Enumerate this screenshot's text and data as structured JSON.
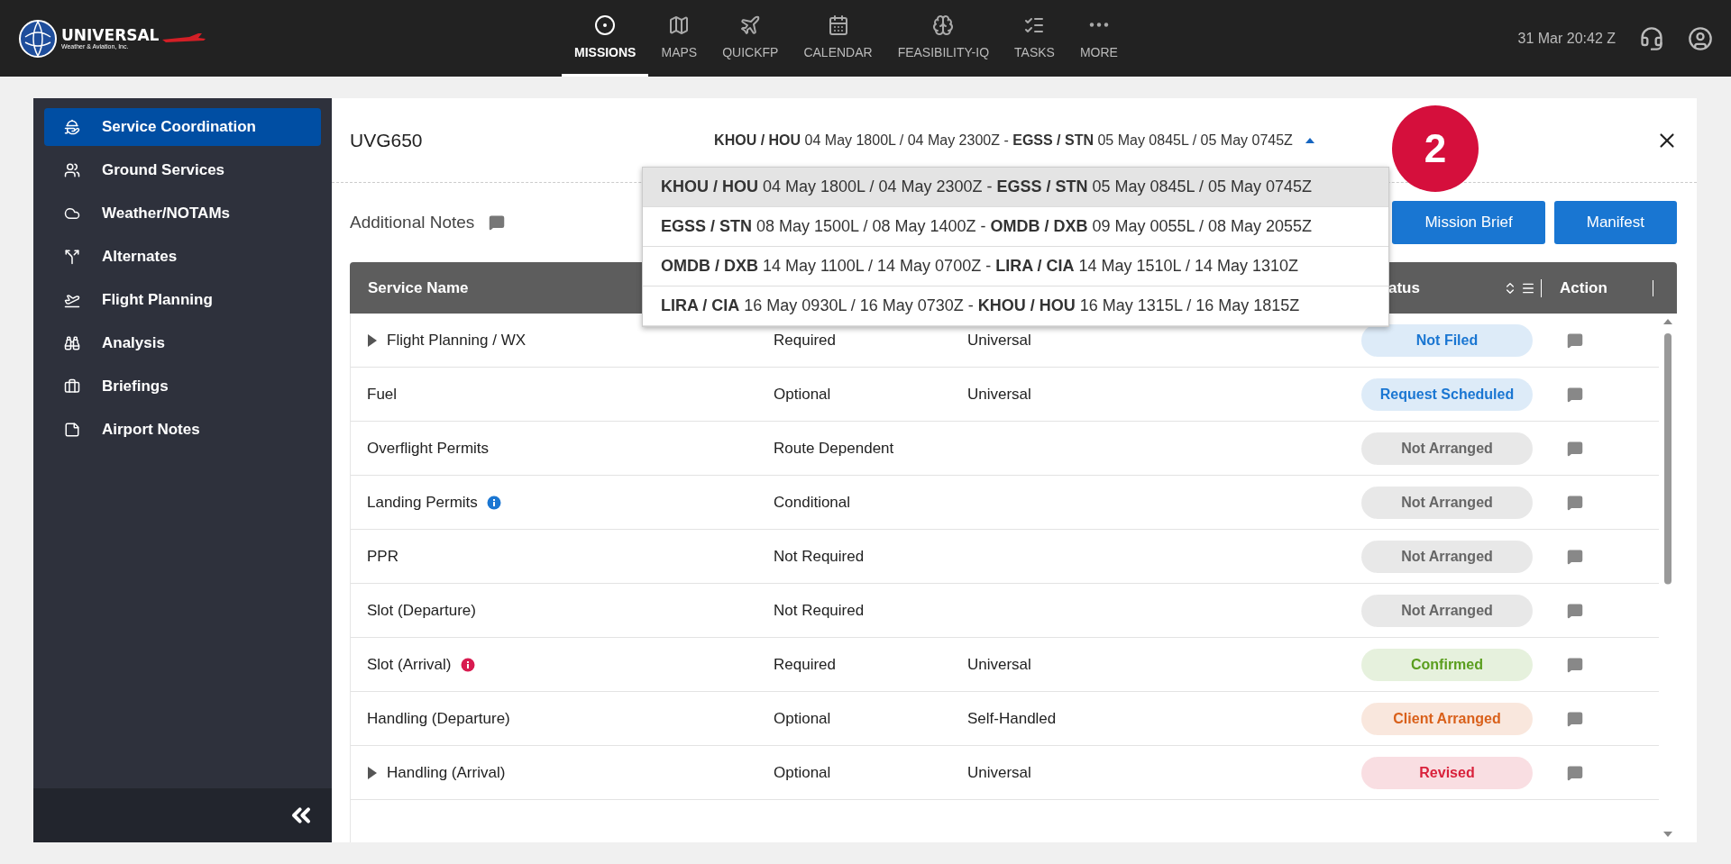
{
  "brand": {
    "name": "UNIVERSAL",
    "tagline": "Weather & Aviation, Inc."
  },
  "nav": [
    {
      "label": "MISSIONS",
      "selected": true
    },
    {
      "label": "MAPS",
      "selected": false
    },
    {
      "label": "QUICKFP",
      "selected": false
    },
    {
      "label": "CALENDAR",
      "selected": false
    },
    {
      "label": "FEASIBILITY-IQ",
      "selected": false
    },
    {
      "label": "TASKS",
      "selected": false
    },
    {
      "label": "MORE",
      "selected": false
    }
  ],
  "clock": "31 Mar 20:42 Z",
  "sidebar": {
    "items": [
      {
        "label": "Service Coordination",
        "selected": true
      },
      {
        "label": "Ground Services",
        "selected": false
      },
      {
        "label": "Weather/NOTAMs",
        "selected": false
      },
      {
        "label": "Alternates",
        "selected": false
      },
      {
        "label": "Flight Planning",
        "selected": false
      },
      {
        "label": "Analysis",
        "selected": false
      },
      {
        "label": "Briefings",
        "selected": false
      },
      {
        "label": "Airport Notes",
        "selected": false
      }
    ]
  },
  "mission": {
    "id": "UVG650",
    "leg": "**KHOU / HOU** 04 May 1800L / 04 May 2300Z - **EGSS / STN** 05 May 0845L / 05 May 0745Z",
    "legs_menu": {
      "expanded": true,
      "items": [
        {
          "text": "**KHOU / HOU** 04 May 1800L / 04 May 2300Z - **EGSS / STN** 05 May 0845L / 05 May 0745Z",
          "selected": true
        },
        {
          "text": "**EGSS / STN** 08 May 1500L / 08 May 1400Z - **OMDB / DXB** 09 May 0055L / 08 May 2055Z",
          "selected": false
        },
        {
          "text": "**OMDB / DXB** 14 May 1100L / 14 May 0700Z - **LIRA / CIA** 14 May 1510L / 14 May 1310Z",
          "selected": false
        },
        {
          "text": "**LIRA / CIA** 16 May 0930L / 16 May 0730Z - **KHOU / HOU** 16 May 1315L / 16 May 1815Z",
          "selected": false
        }
      ]
    }
  },
  "annotation": "2",
  "notes_label": "Additional Notes",
  "buttons": [
    "Mission Brief",
    "Manifest"
  ],
  "table": {
    "columns": {
      "service": "Service Name",
      "status": "atus",
      "action": "Action"
    },
    "rows": [
      {
        "name": "Flight Planning / WX",
        "expandable": true,
        "requirement": "Required",
        "provider": "Universal",
        "status": {
          "label": "Not Filed",
          "color": "#1a76d2"
        }
      },
      {
        "name": "Fuel",
        "expandable": false,
        "requirement": "Optional",
        "provider": "Universal",
        "status": {
          "label": "Request Scheduled",
          "color": "#1a76d2"
        }
      },
      {
        "name": "Overflight Permits",
        "expandable": false,
        "requirement": "Route Dependent",
        "status": {
          "label": "Not Arranged",
          "color": "#666666"
        }
      },
      {
        "name": "Landing Permits",
        "expandable": false,
        "info": {
          "color": "#1a76d2"
        },
        "requirement": "Conditional",
        "status": {
          "label": "Not Arranged",
          "color": "#666666"
        }
      },
      {
        "name": "PPR",
        "expandable": false,
        "requirement": "Not Required",
        "status": {
          "label": "Not Arranged",
          "color": "#666666"
        }
      },
      {
        "name": "Slot (Departure)",
        "expandable": false,
        "requirement": "Not Required",
        "status": {
          "label": "Not Arranged",
          "color": "#666666"
        }
      },
      {
        "name": "Slot (Arrival)",
        "expandable": false,
        "info": {
          "color": "#d81b50"
        },
        "requirement": "Required",
        "provider": "Universal",
        "status": {
          "label": "Confirmed",
          "color": "#5a9e1e"
        }
      },
      {
        "name": "Handling (Departure)",
        "expandable": false,
        "requirement": "Optional",
        "provider": "Self-Handled",
        "status": {
          "label": "Client Arranged",
          "color": "#d9601a"
        }
      },
      {
        "name": "Handling (Arrival)",
        "expandable": true,
        "requirement": "Optional",
        "provider": "Universal",
        "status": {
          "label": "Revised",
          "color": "#d9213b"
        }
      }
    ]
  }
}
